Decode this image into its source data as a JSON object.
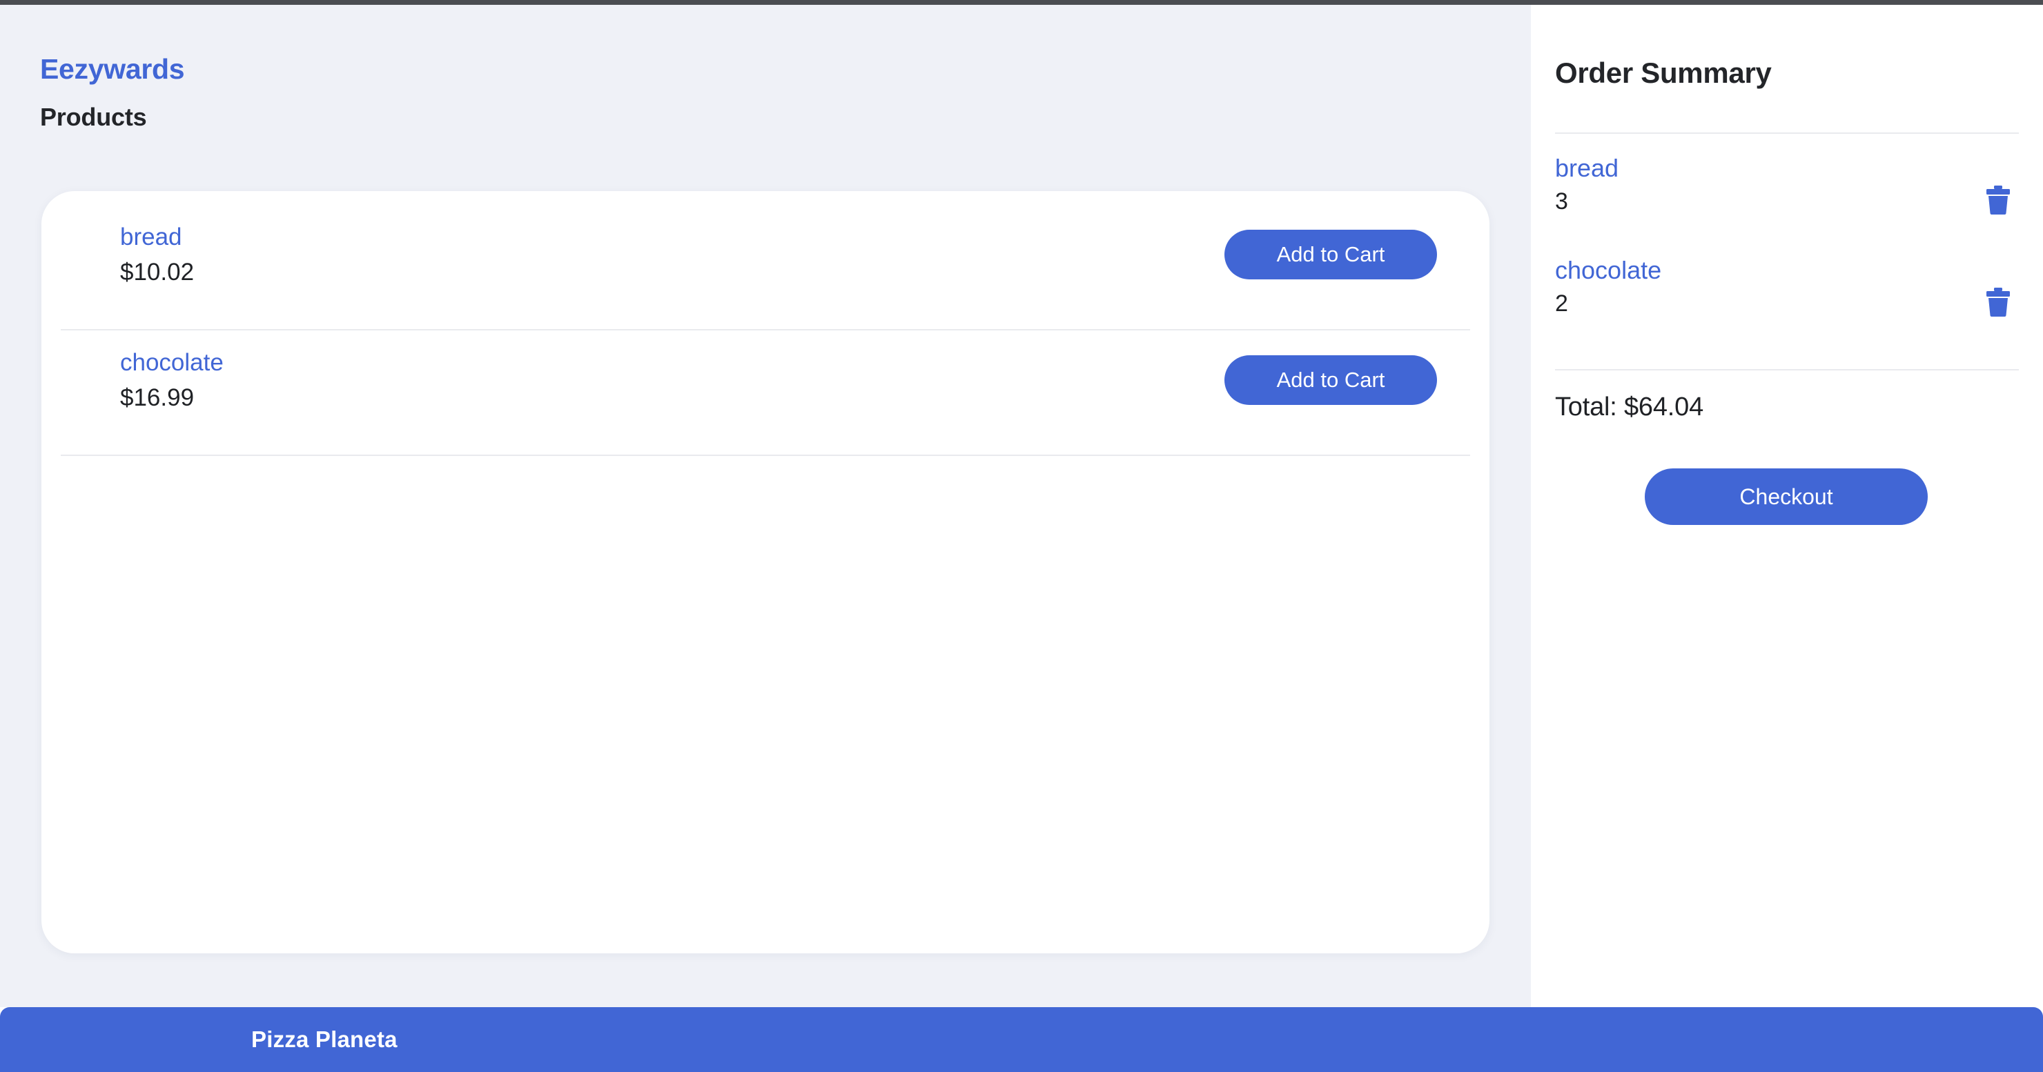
{
  "window": {
    "top_strip_color": "#4b4d52"
  },
  "theme": {
    "accent": "#4166d5",
    "page_bg": "#eff1f7",
    "panel_bg": "#ffffff",
    "text": "#232529",
    "divider": "#e9eaee"
  },
  "header": {
    "brand": "Eezywards",
    "page_title": "Products"
  },
  "products": [
    {
      "name": "bread",
      "price": "$10.02",
      "add_label": "Add to Cart"
    },
    {
      "name": "chocolate",
      "price": "$16.99",
      "add_label": "Add to Cart"
    }
  ],
  "order_summary": {
    "title": "Order Summary",
    "items": [
      {
        "name": "bread",
        "quantity": "3",
        "remove_icon": "trash-icon"
      },
      {
        "name": "chocolate",
        "quantity": "2",
        "remove_icon": "trash-icon"
      }
    ],
    "total": "Total: $64.04",
    "checkout_label": "Checkout"
  },
  "bottom_bar": {
    "label": "Pizza Planeta"
  }
}
